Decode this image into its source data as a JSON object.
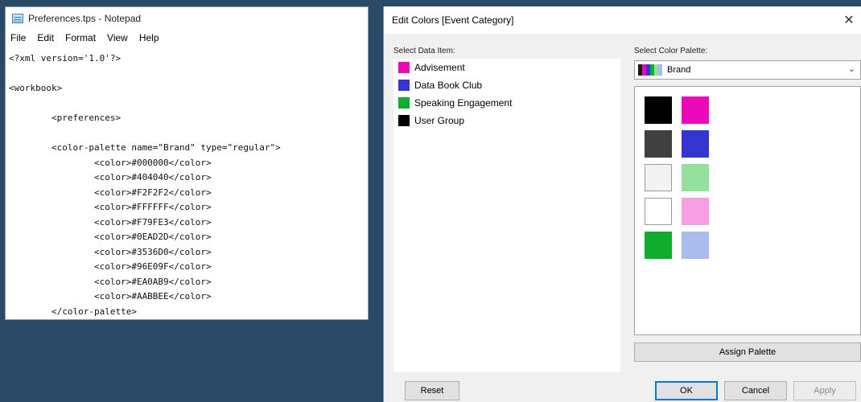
{
  "notepad": {
    "title": "Preferences.tps - Notepad",
    "menu": [
      "File",
      "Edit",
      "Format",
      "View",
      "Help"
    ],
    "lines": [
      "<?xml version='1.0'?>",
      "",
      "<workbook>",
      "",
      "        <preferences>",
      "",
      "        <color-palette name=\"Brand\" type=\"regular\">",
      "                <color>#000000</color>",
      "                <color>#404040</color>",
      "                <color>#F2F2F2</color>",
      "                <color>#FFFFFF</color>",
      "                <color>#F79FE3</color>",
      "                <color>#0EAD2D</color>",
      "                <color>#3536D0</color>",
      "                <color>#96E09F</color>",
      "                <color>#EA0AB9</color>",
      "                <color>#AABBEE</color>",
      "        </color-palette>"
    ]
  },
  "dialog": {
    "title": "Edit Colors [Event Category]",
    "close_glyph": "✕",
    "select_item_label": "Select Data Item:",
    "select_palette_label": "Select Color Palette:",
    "palette_selected": "Brand",
    "palette_preview_colors": [
      "#1a1a1a",
      "#ea0ab9",
      "#3536d0",
      "#0ead2d",
      "#96e09f",
      "#aabbee"
    ],
    "items": [
      {
        "label": "Advisement",
        "color": "#EA0AB9"
      },
      {
        "label": "Data Book Club",
        "color": "#3536D0"
      },
      {
        "label": "Speaking Engagement",
        "color": "#0EAD2D"
      },
      {
        "label": "User Group",
        "color": "#000000"
      }
    ],
    "palette_swatches": [
      "#000000",
      "#EA0AB9",
      "#404040",
      "#3536D0",
      "#F2F2F2",
      "#96E09F",
      "#FFFFFF",
      "#F79FE3",
      "#0EAD2D",
      "#AABBEE"
    ],
    "buttons": {
      "assign": "Assign Palette",
      "reset": "Reset",
      "ok": "OK",
      "cancel": "Cancel",
      "apply": "Apply"
    }
  }
}
